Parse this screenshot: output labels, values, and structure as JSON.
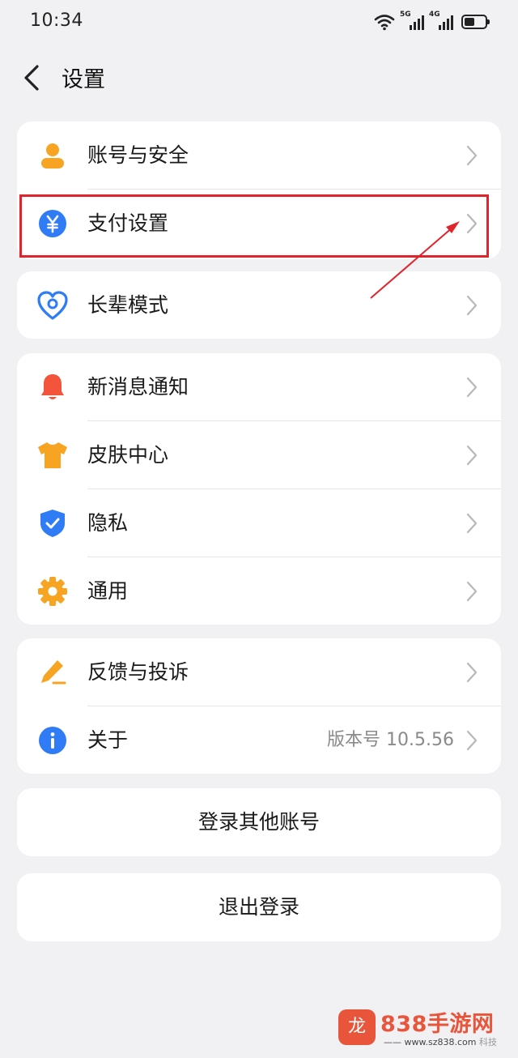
{
  "statusbar": {
    "time": "10:34",
    "net1": "5G",
    "net2": "4G",
    "battery_level": 0.5
  },
  "header": {
    "back_icon": "chevron-left-icon",
    "title": "设置"
  },
  "groups": {
    "account": {
      "label": "账号与安全",
      "icon": "person-icon"
    },
    "payment": {
      "label": "支付设置",
      "icon": "yuan-icon"
    },
    "elder": {
      "label": "长辈模式",
      "icon": "heart-icon"
    },
    "notify": {
      "label": "新消息通知",
      "icon": "bell-icon"
    },
    "skin": {
      "label": "皮肤中心",
      "icon": "tshirt-icon"
    },
    "privacy": {
      "label": "隐私",
      "icon": "shield-icon"
    },
    "general": {
      "label": "通用",
      "icon": "gear-icon"
    },
    "feedback": {
      "label": "反馈与投诉",
      "icon": "pencil-icon"
    },
    "about": {
      "label": "关于",
      "icon": "info-icon",
      "value": "版本号 10.5.56"
    }
  },
  "buttons": {
    "switch_account": "登录其他账号",
    "logout": "退出登录"
  },
  "watermark": {
    "brand": "838手游网",
    "url": "www.sz838.com",
    "faint": "科技"
  },
  "colors": {
    "orange": "#f6a421",
    "blue": "#2f7cf6",
    "red": "#f2553b",
    "highlight": "#e0242c"
  }
}
